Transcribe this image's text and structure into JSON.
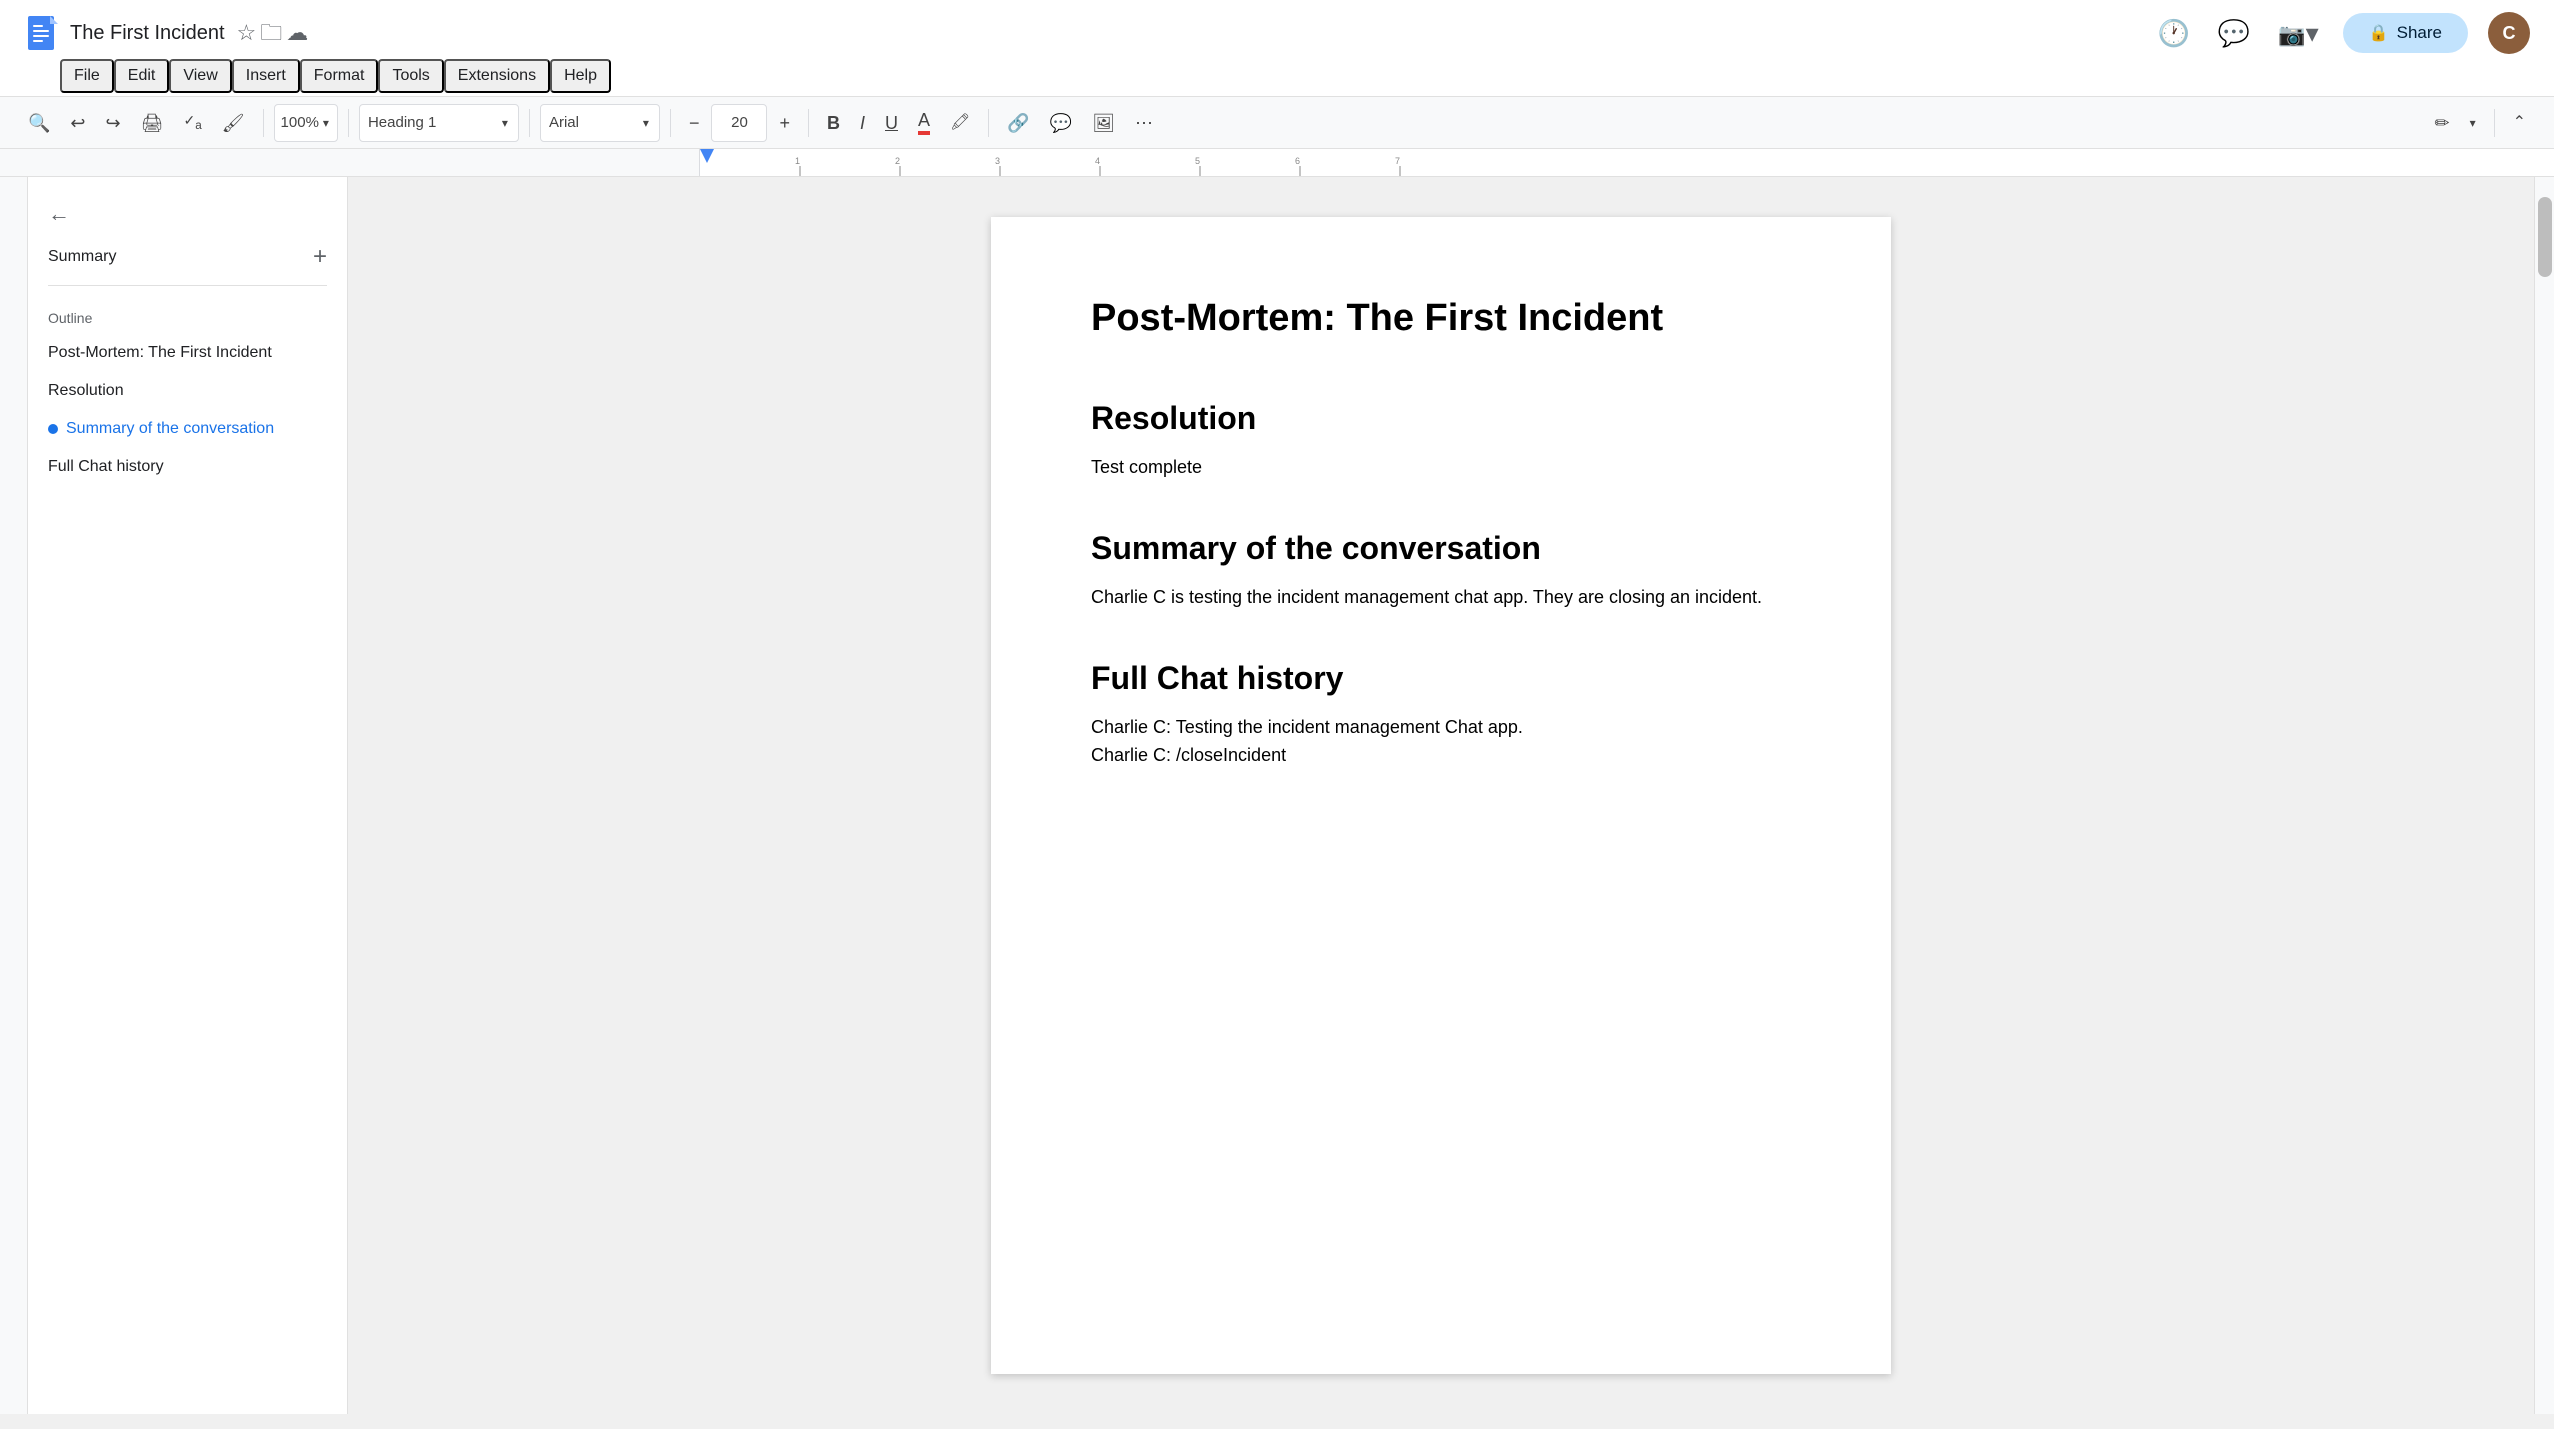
{
  "app": {
    "title": "The First Incident",
    "doc_icon_color": "#4285f4",
    "share_label": "Share"
  },
  "menu": {
    "items": [
      "File",
      "Edit",
      "View",
      "Insert",
      "Format",
      "Tools",
      "Extensions",
      "Help"
    ]
  },
  "toolbar": {
    "zoom": "100%",
    "zoom_suffix": "▾",
    "heading_style": "Heading 1",
    "font": "Arial",
    "font_size": "20",
    "bold": "B",
    "italic": "I",
    "underline": "U",
    "more": "⋯"
  },
  "outline": {
    "back_label": "←",
    "summary_label": "Summary",
    "add_label": "+",
    "section_label": "Outline",
    "items": [
      {
        "label": "Post-Mortem: The First Incident",
        "active": false
      },
      {
        "label": "Resolution",
        "active": false
      },
      {
        "label": "Summary of the conversation",
        "active": true
      },
      {
        "label": "Full Chat history",
        "active": false
      }
    ]
  },
  "document": {
    "title": "Post-Mortem: The First Incident",
    "sections": [
      {
        "heading": "Resolution",
        "body": "Test complete"
      },
      {
        "heading": "Summary of the conversation",
        "body": "Charlie C is testing the incident management chat app. They are closing an incident."
      },
      {
        "heading": "Full Chat history",
        "body": "Charlie C: Testing the incident management Chat app.\nCharlie C: /closeIncident"
      }
    ]
  },
  "icons": {
    "back": "←",
    "star": "☆",
    "folder": "🗀",
    "cloud": "☁",
    "history": "🕐",
    "comment": "💬",
    "camera": "📷",
    "lock": "🔒",
    "search": "🔍",
    "undo": "↩",
    "redo": "↪",
    "print": "🖨",
    "spell": "✓",
    "paint": "🖌",
    "minus": "−",
    "plus": "+",
    "link": "🔗",
    "table": "⊞",
    "image": "🖼",
    "pencil": "✏",
    "chevron_up": "⌃",
    "chevron_down": "⌄",
    "more_vert": "⋮",
    "more_horiz": "⋯"
  },
  "colors": {
    "active_outline": "#1a73e8",
    "share_bg": "#c2e3fd",
    "toolbar_bg": "#f8f9fa",
    "doc_bg": "#fff",
    "page_shadow": "0 2px 8px rgba(0,0,0,0.2)"
  }
}
